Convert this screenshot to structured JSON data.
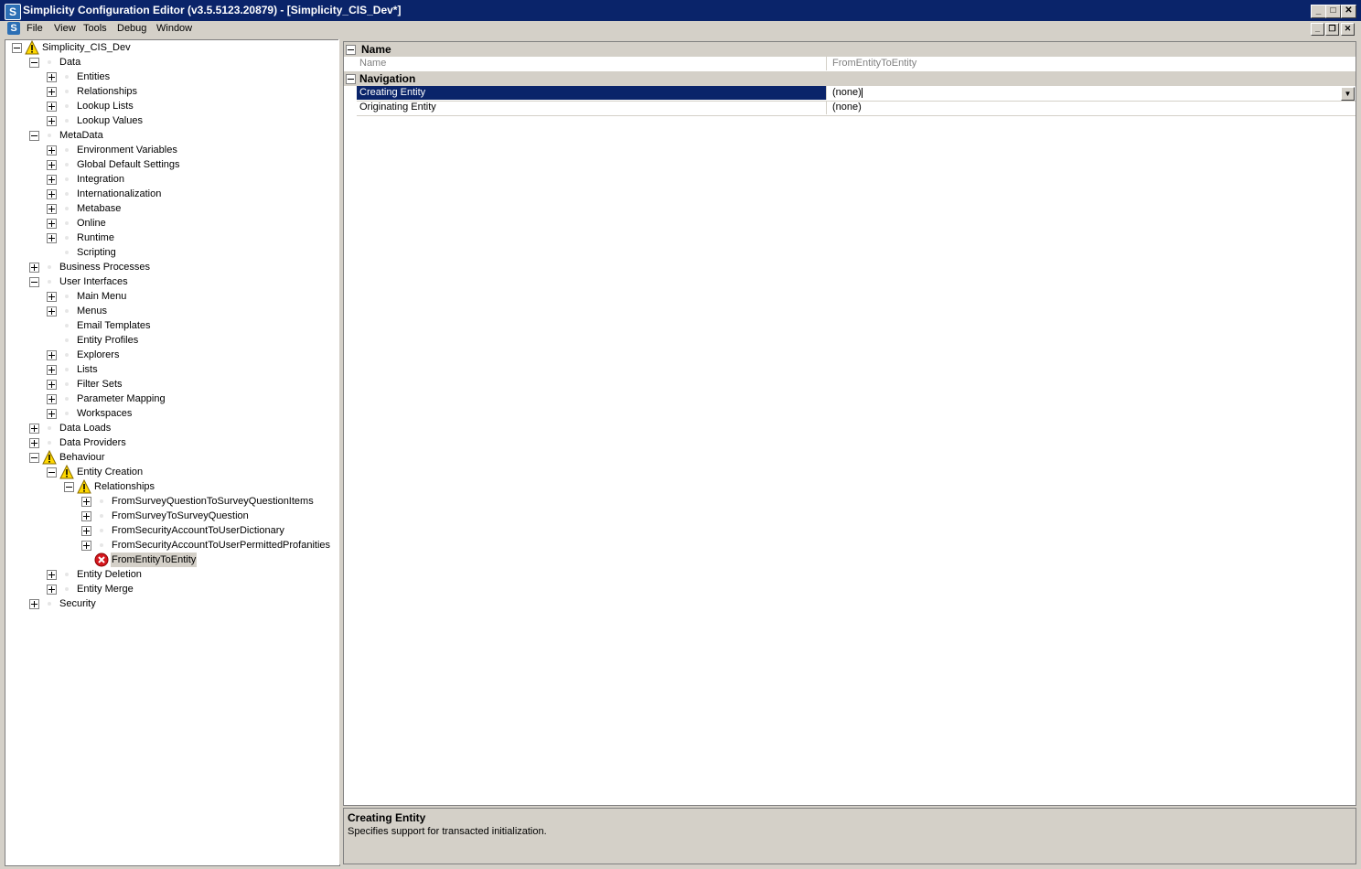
{
  "window": {
    "title": "Simplicity Configuration Editor (v3.5.5123.20879) - [Simplicity_CIS_Dev*]",
    "app_icon_letter": "S",
    "minimize_glyph": "_",
    "maximize_glyph": "□",
    "close_glyph": "✕",
    "restore_glyph": "❐"
  },
  "menu": {
    "items": [
      "File",
      "View",
      "Tools",
      "Debug",
      "Window"
    ]
  },
  "tree": {
    "nodes": [
      {
        "label": "Simplicity_CIS_Dev",
        "expander": "minus",
        "icon": "warning-icon"
      },
      {
        "label": "Data",
        "expander": "minus",
        "icon": "dot-icon"
      },
      {
        "label": "Entities",
        "expander": "plus",
        "icon": "dot-icon"
      },
      {
        "label": "Relationships",
        "expander": "plus",
        "icon": "dot-icon"
      },
      {
        "label": "Lookup Lists",
        "expander": "plus",
        "icon": "dot-icon"
      },
      {
        "label": "Lookup Values",
        "expander": "plus",
        "icon": "dot-icon"
      },
      {
        "label": "MetaData",
        "expander": "minus",
        "icon": "dot-icon"
      },
      {
        "label": "Environment Variables",
        "expander": "plus",
        "icon": "dot-icon"
      },
      {
        "label": "Global Default Settings",
        "expander": "plus",
        "icon": "dot-icon"
      },
      {
        "label": "Integration",
        "expander": "plus",
        "icon": "dot-icon"
      },
      {
        "label": "Internationalization",
        "expander": "plus",
        "icon": "dot-icon"
      },
      {
        "label": "Metabase",
        "expander": "plus",
        "icon": "dot-icon"
      },
      {
        "label": "Online",
        "expander": "plus",
        "icon": "dot-icon"
      },
      {
        "label": "Runtime",
        "expander": "plus",
        "icon": "dot-icon"
      },
      {
        "label": "Scripting",
        "expander": "none",
        "icon": "dot-icon"
      },
      {
        "label": "Business Processes",
        "expander": "plus",
        "icon": "dot-icon"
      },
      {
        "label": "User Interfaces",
        "expander": "minus",
        "icon": "dot-icon"
      },
      {
        "label": "Main Menu",
        "expander": "plus",
        "icon": "dot-icon"
      },
      {
        "label": "Menus",
        "expander": "plus",
        "icon": "dot-icon"
      },
      {
        "label": "Email Templates",
        "expander": "none",
        "icon": "dot-icon"
      },
      {
        "label": "Entity Profiles",
        "expander": "none",
        "icon": "dot-icon"
      },
      {
        "label": "Explorers",
        "expander": "plus",
        "icon": "dot-icon"
      },
      {
        "label": "Lists",
        "expander": "plus",
        "icon": "dot-icon"
      },
      {
        "label": "Filter Sets",
        "expander": "plus",
        "icon": "dot-icon"
      },
      {
        "label": "Parameter Mapping",
        "expander": "plus",
        "icon": "dot-icon"
      },
      {
        "label": "Workspaces",
        "expander": "plus",
        "icon": "dot-icon"
      },
      {
        "label": "Data Loads",
        "expander": "plus",
        "icon": "dot-icon"
      },
      {
        "label": "Data Providers",
        "expander": "plus",
        "icon": "dot-icon"
      },
      {
        "label": "Behaviour",
        "expander": "minus",
        "icon": "warning-icon"
      },
      {
        "label": "Entity Creation",
        "expander": "minus",
        "icon": "warning-icon"
      },
      {
        "label": "Relationships",
        "expander": "minus",
        "icon": "warning-icon"
      },
      {
        "label": "FromSurveyQuestionToSurveyQuestionItems",
        "expander": "plus",
        "icon": "dot-icon"
      },
      {
        "label": "FromSurveyToSurveyQuestion",
        "expander": "plus",
        "icon": "dot-icon"
      },
      {
        "label": "FromSecurityAccountToUserDictionary",
        "expander": "plus",
        "icon": "dot-icon"
      },
      {
        "label": "FromSecurityAccountToUserPermittedProfanities",
        "expander": "plus",
        "icon": "dot-icon"
      },
      {
        "label": "FromEntityToEntity",
        "expander": "none",
        "icon": "error-icon",
        "selected": true
      },
      {
        "label": "Entity Deletion",
        "expander": "plus",
        "icon": "dot-icon"
      },
      {
        "label": "Entity Merge",
        "expander": "plus",
        "icon": "dot-icon"
      },
      {
        "label": "Security",
        "expander": "plus",
        "icon": "dot-icon"
      }
    ]
  },
  "properties": {
    "categories": {
      "name": "Name",
      "navigation": "Navigation"
    },
    "rows": {
      "name": {
        "label": "Name",
        "value": "FromEntityToEntity"
      },
      "creating_entity": {
        "label": "Creating Entity",
        "value": "(none)"
      },
      "originating_entity": {
        "label": "Originating Entity",
        "value": "(none)"
      }
    },
    "dropdown_glyph": "▼"
  },
  "description": {
    "title": "Creating Entity",
    "text": "Specifies support for transacted initialization."
  },
  "colors": {
    "title_bar": "#0a246a",
    "selection": "#0a246a",
    "warning": "#ffd800",
    "error": "#d4171e"
  }
}
